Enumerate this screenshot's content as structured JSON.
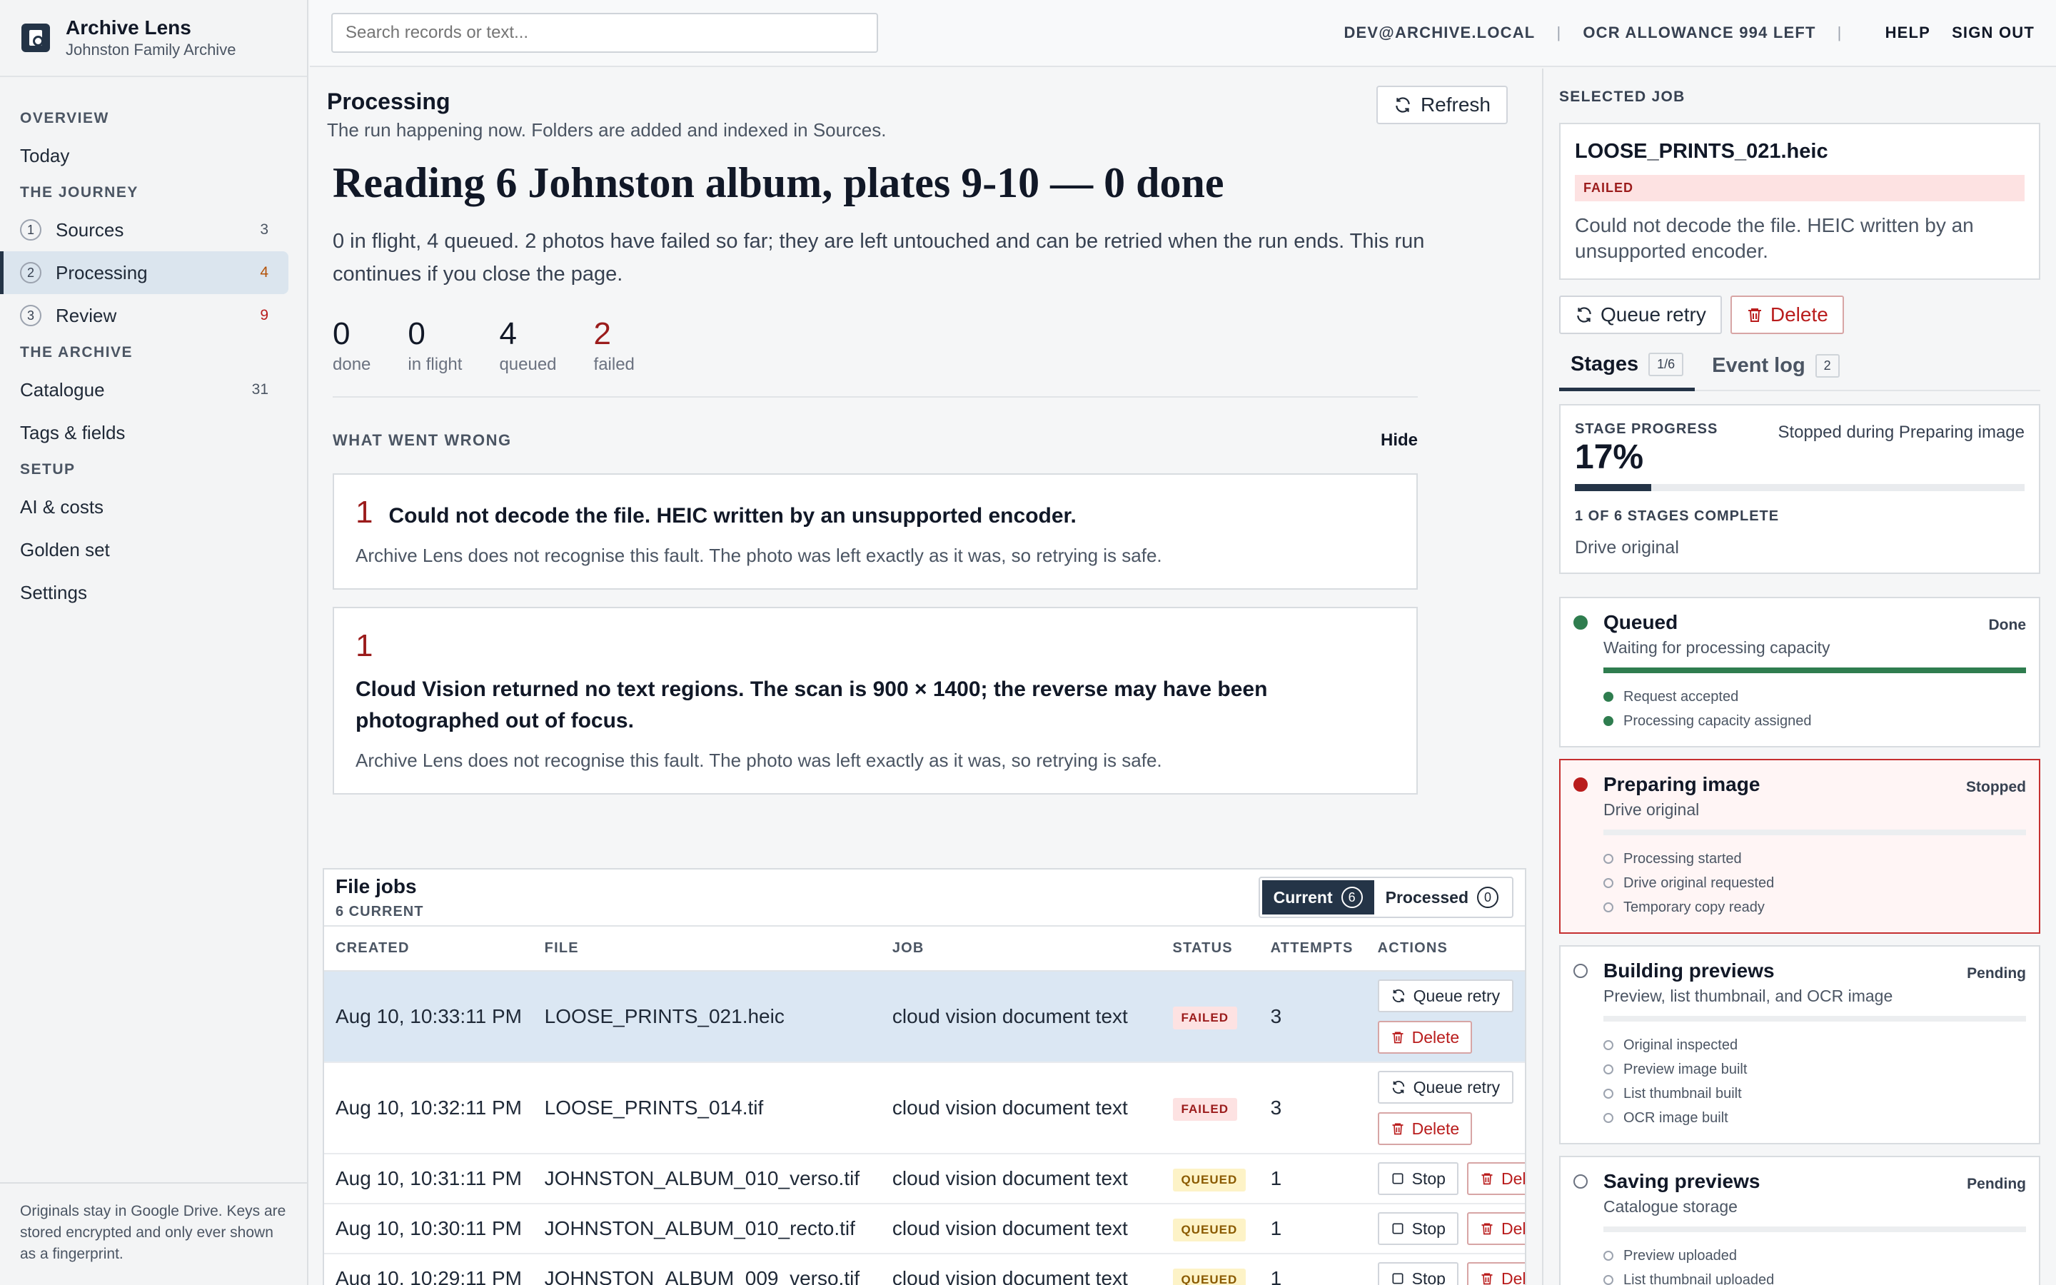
{
  "brand": {
    "title": "Archive Lens",
    "subtitle": "Johnston Family Archive"
  },
  "nav": {
    "overview": "OVERVIEW",
    "today": "Today",
    "journey": "THE JOURNEY",
    "sources": {
      "num": "1",
      "label": "Sources",
      "count": "3"
    },
    "processing": {
      "num": "2",
      "label": "Processing",
      "count": "4"
    },
    "review": {
      "num": "3",
      "label": "Review",
      "count": "9"
    },
    "archive": "THE ARCHIVE",
    "catalogue": {
      "label": "Catalogue",
      "count": "31"
    },
    "tags": "Tags & fields",
    "setup": "SETUP",
    "ai": "AI & costs",
    "golden": "Golden set",
    "settings": "Settings"
  },
  "sidebar_footer": "Originals stay in Google Drive. Keys are stored encrypted and only ever shown as a fingerprint.",
  "topbar": {
    "search_placeholder": "Search records or text...",
    "user": "DEV@ARCHIVE.LOCAL",
    "ocr": "OCR ALLOWANCE 994 LEFT",
    "help": "HELP",
    "signout": "SIGN OUT"
  },
  "page": {
    "title": "Processing",
    "subtitle": "The run happening now. Folders are added and indexed in Sources.",
    "refresh": "Refresh",
    "headline": "Reading 6 Johnston album, plates 9-10 — 0 done",
    "lead": "0 in flight, 4 queued. 2 photos have failed so far; they are left untouched and can be retried when the run ends. This run continues if you close the page."
  },
  "stats": [
    {
      "value": "0",
      "label": "done"
    },
    {
      "value": "0",
      "label": "in flight"
    },
    {
      "value": "4",
      "label": "queued"
    },
    {
      "value": "2",
      "label": "failed"
    }
  ],
  "wrong": {
    "title": "WHAT WENT WRONG",
    "hide": "Hide",
    "faults": [
      {
        "count": "1",
        "message": "Could not decode the file. HEIC written by an unsupported encoder.",
        "note": "Archive Lens does not recognise this fault. The photo was left exactly as it was, so retrying is safe."
      },
      {
        "count": "1",
        "message": "Cloud Vision returned no text regions. The scan is 900 × 1400; the reverse may have been photographed out of focus.",
        "note": "Archive Lens does not recognise this fault. The photo was left exactly as it was, so retrying is safe."
      }
    ]
  },
  "jobs": {
    "title": "File jobs",
    "count": "6 CURRENT",
    "seg_current": "Current",
    "seg_current_count": "6",
    "seg_processed": "Processed",
    "seg_processed_count": "0",
    "columns": [
      "CREATED",
      "FILE",
      "JOB",
      "STATUS",
      "ATTEMPTS",
      "ACTIONS"
    ],
    "rows": [
      {
        "created": "Aug 10, 10:33:11 PM",
        "file": "LOOSE_PRINTS_021.heic",
        "job": "cloud vision document text",
        "status": "FAILED",
        "attempts": "3"
      },
      {
        "created": "Aug 10, 10:32:11 PM",
        "file": "LOOSE_PRINTS_014.tif",
        "job": "cloud vision document text",
        "status": "FAILED",
        "attempts": "3"
      },
      {
        "created": "Aug 10, 10:31:11 PM",
        "file": "JOHNSTON_ALBUM_010_verso.tif",
        "job": "cloud vision document text",
        "status": "QUEUED",
        "attempts": "1"
      },
      {
        "created": "Aug 10, 10:30:11 PM",
        "file": "JOHNSTON_ALBUM_010_recto.tif",
        "job": "cloud vision document text",
        "status": "QUEUED",
        "attempts": "1"
      },
      {
        "created": "Aug 10, 10:29:11 PM",
        "file": "JOHNSTON_ALBUM_009_verso.tif",
        "job": "cloud vision document text",
        "status": "QUEUED",
        "attempts": "1"
      }
    ],
    "retry": "Queue retry",
    "delete": "Delete",
    "stop": "Stop"
  },
  "panel": {
    "label": "SELECTED JOB",
    "file": "LOOSE_PRINTS_021.heic",
    "status": "FAILED",
    "desc": "Could not decode the file. HEIC written by an unsupported encoder.",
    "retry": "Queue retry",
    "delete": "Delete",
    "tab_stages": "Stages",
    "tab_stages_count": "1/6",
    "tab_log": "Event log",
    "tab_log_count": "2",
    "progress_label": "STAGE PROGRESS",
    "progress_pct": "17%",
    "progress_value": 17,
    "progress_note": "Stopped during Preparing image",
    "stages_complete": "1 OF 6 STAGES COMPLETE",
    "stage_origin": "Drive original",
    "stages": [
      {
        "name": "Queued",
        "state": "Done",
        "desc": "Waiting for processing capacity",
        "progress": 100,
        "steps": [
          "Request accepted",
          "Processing capacity assigned"
        ],
        "steps_done": [
          true,
          true
        ]
      },
      {
        "name": "Preparing image",
        "state": "Stopped",
        "desc": "Drive original",
        "progress": 0,
        "steps": [
          "Processing started",
          "Drive original requested",
          "Temporary copy ready"
        ],
        "steps_done": [
          false,
          false,
          false
        ]
      },
      {
        "name": "Building previews",
        "state": "Pending",
        "desc": "Preview, list thumbnail, and OCR image",
        "progress": 0,
        "steps": [
          "Original inspected",
          "Preview image built",
          "List thumbnail built",
          "OCR image built"
        ],
        "steps_done": [
          false,
          false,
          false,
          false
        ]
      },
      {
        "name": "Saving previews",
        "state": "Pending",
        "desc": "Catalogue storage",
        "progress": 0,
        "steps": [
          "Preview uploaded",
          "List thumbnail uploaded"
        ],
        "steps_done": [
          false,
          false
        ]
      }
    ]
  }
}
